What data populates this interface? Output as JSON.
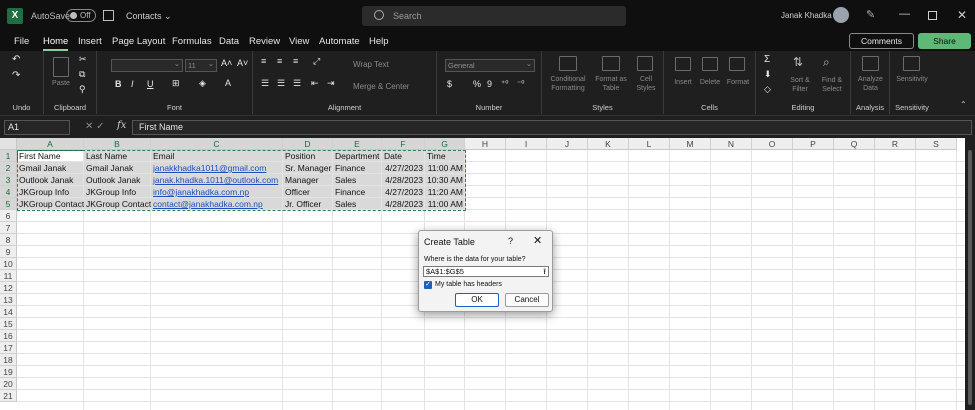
{
  "titlebar": {
    "autosave_label": "AutoSave",
    "autosave_state": "Off",
    "filename": "Contacts ⌄",
    "search_placeholder": "Search",
    "user_name": "Janak Khadka"
  },
  "menu": {
    "tabs": [
      "File",
      "Home",
      "Insert",
      "Page Layout",
      "Formulas",
      "Data",
      "Review",
      "View",
      "Automate",
      "Help"
    ],
    "active_tab": "Home",
    "comments_label": "Comments",
    "share_label": "Share"
  },
  "ribbon": {
    "groups": {
      "undo": "Undo",
      "clipboard": "Clipboard",
      "font": "Font",
      "alignment": "Alignment",
      "number": "Number",
      "styles": "Styles",
      "cells": "Cells",
      "editing": "Editing",
      "analysis": "Analysis",
      "sensitivity": "Sensitivity"
    },
    "paste_label": "Paste",
    "font_size_value": "11",
    "wrap_text": "Wrap Text",
    "merge_center": "Merge & Center",
    "number_format": "General",
    "conditional_formatting": "Conditional Formatting",
    "format_as_table": "Format as Table",
    "cell_styles": "Cell Styles",
    "insert": "Insert",
    "delete": "Delete",
    "format": "Format",
    "sort_filter": "Sort & Filter",
    "find_select": "Find & Select",
    "analyze_data": "Analyze Data",
    "sensitivity": "Sensitivity"
  },
  "formula_bar": {
    "name_box": "A1",
    "fx": "fx",
    "formula": "First Name"
  },
  "sheet": {
    "columns": [
      "A",
      "B",
      "C",
      "D",
      "E",
      "F",
      "G",
      "H",
      "I",
      "J",
      "K",
      "L",
      "M",
      "N",
      "O",
      "P",
      "Q",
      "R",
      "S"
    ],
    "rows": [
      "1",
      "2",
      "3",
      "4",
      "5",
      "6",
      "7",
      "8",
      "9",
      "10",
      "11",
      "12",
      "13",
      "14",
      "15",
      "16",
      "17",
      "18",
      "19",
      "20",
      "21"
    ],
    "headers": [
      "First Name",
      "Last Name",
      "Email",
      "Position",
      "Department",
      "Date",
      "Time"
    ],
    "data": [
      [
        "Gmail Janak",
        "Gmail Janak",
        "janakkhadka1011@gmail.com",
        "Sr. Manager",
        "Finance",
        "4/27/2023",
        "11:00 AM"
      ],
      [
        "Outlook Janak",
        "Outlook Janak",
        "janak.khadka.1011@outlook.com",
        "Manager",
        "Sales",
        "4/28/2023",
        "10:30 AM"
      ],
      [
        "JKGroup Info",
        "JKGroup Info",
        "info@janakhadka.com.np",
        "Officer",
        "Finance",
        "4/27/2023",
        "11:20 AM"
      ],
      [
        "JKGroup Contact",
        "JKGroup Contact",
        "contact@janakhadka.com.np",
        "Jr. Officer",
        "Sales",
        "4/28/2023",
        "11:00 AM"
      ]
    ]
  },
  "dialog": {
    "title": "Create Table",
    "help": "?",
    "close": "✕",
    "prompt": "Where is the data for your table?",
    "range": "$A$1:$G$5",
    "checkbox_label": "My table has headers",
    "checkbox_checked": true,
    "ok": "OK",
    "cancel": "Cancel"
  }
}
